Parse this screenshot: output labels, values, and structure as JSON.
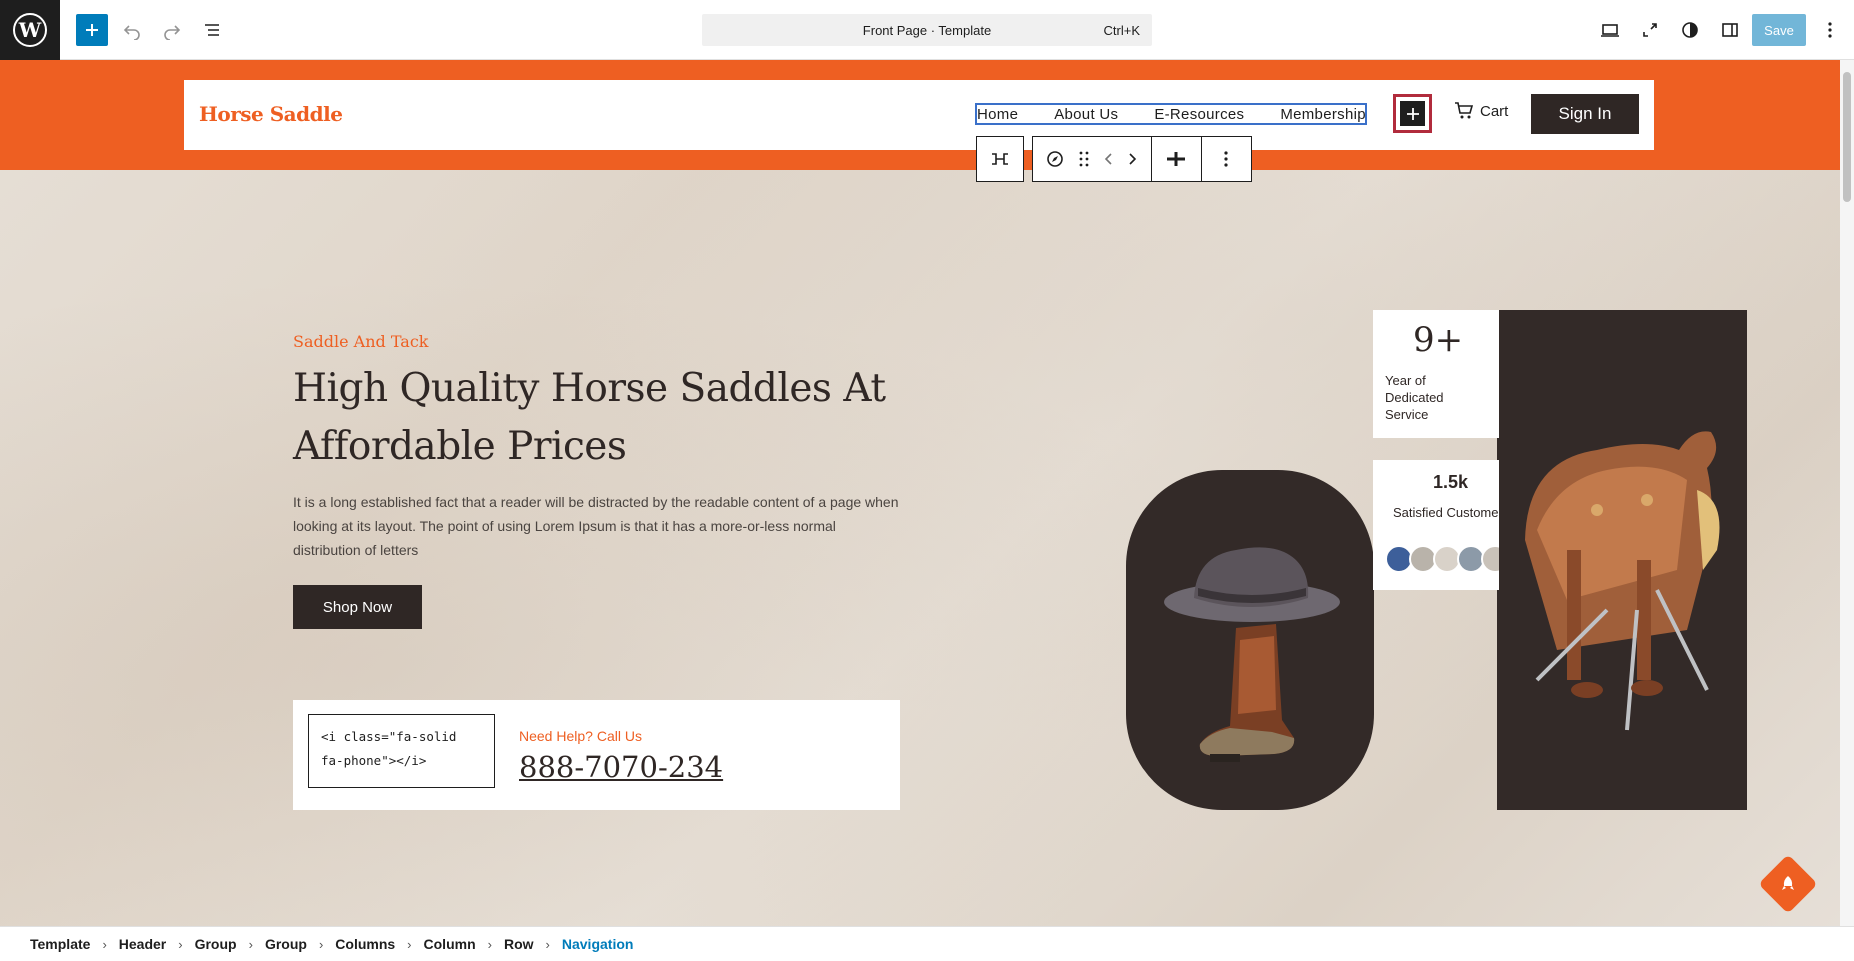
{
  "editor": {
    "command_bar": {
      "label": "Front Page · Template",
      "shortcut": "Ctrl+K"
    },
    "save_label": "Save"
  },
  "header": {
    "site_title": "Horse Saddle",
    "nav": [
      "Home",
      "About Us",
      "E-Resources",
      "Membership"
    ],
    "cart_label": "Cart",
    "signin_label": "Sign In"
  },
  "hero": {
    "eyebrow": "Saddle And Tack",
    "headline": "High Quality Horse Saddles At Affordable Prices",
    "description": "It is a long established fact that a reader will be distracted by the readable content of a page when looking at its layout. The point of using Lorem Ipsum is that it has a more-or-less normal distribution of letters",
    "shop_button": "Shop Now",
    "help": {
      "code": "<i class=\"fa-solid fa-phone\"></i>",
      "label": "Need Help? Call Us",
      "phone": "888-7070-234"
    }
  },
  "stats": {
    "years_value": "9+",
    "years_label": "Year of Dedicated Service",
    "customers_value": "1.5k",
    "customers_label": "Satisfied Customers"
  },
  "breadcrumb": [
    "Template",
    "Header",
    "Group",
    "Group",
    "Columns",
    "Column",
    "Row",
    "Navigation"
  ],
  "colors": {
    "accent": "#ee5f22",
    "dark": "#2f2725",
    "wp_blue": "#007cba",
    "selection": "#b12b3c"
  }
}
